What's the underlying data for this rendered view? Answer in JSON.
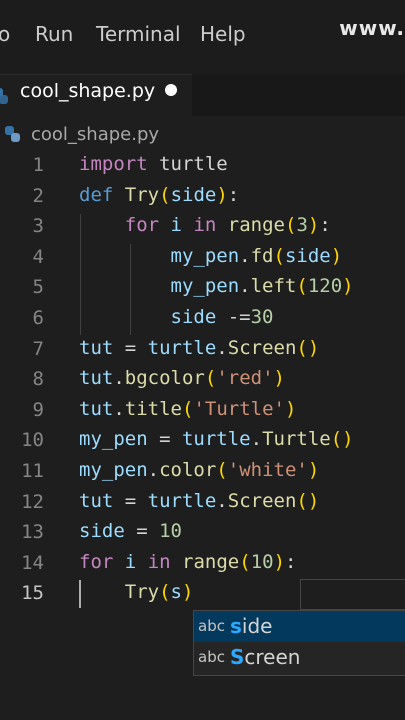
{
  "menubar": {
    "items": [
      "o",
      "Run",
      "Terminal",
      "Help"
    ],
    "watermark": "www."
  },
  "tab": {
    "label": "cool_shape.py",
    "dirty": true
  },
  "breadcrumb": {
    "file": "cool_shape.py"
  },
  "editor": {
    "active_line": 15,
    "lines": [
      {
        "n": "1",
        "tokens": [
          [
            "import",
            "ctl"
          ],
          [
            " turtle",
            ""
          ]
        ]
      },
      {
        "n": "2",
        "tokens": [
          [
            "def",
            "kw"
          ],
          [
            " ",
            ""
          ],
          [
            "Try",
            "fn"
          ],
          [
            "(",
            "bp"
          ],
          [
            "side",
            "var"
          ],
          [
            ")",
            "bp"
          ],
          [
            ":",
            ""
          ]
        ]
      },
      {
        "n": "3",
        "tokens": [
          [
            "    ",
            ""
          ],
          [
            "for",
            "ctl"
          ],
          [
            " ",
            ""
          ],
          [
            "i",
            "var"
          ],
          [
            " ",
            ""
          ],
          [
            "in",
            "ctl"
          ],
          [
            " ",
            ""
          ],
          [
            "range",
            "fn"
          ],
          [
            "(",
            "bp"
          ],
          [
            "3",
            "num"
          ],
          [
            ")",
            "bp"
          ],
          [
            ":",
            ""
          ]
        ]
      },
      {
        "n": "4",
        "tokens": [
          [
            "        ",
            ""
          ],
          [
            "my_pen",
            "var"
          ],
          [
            ".",
            ""
          ],
          [
            "fd",
            "fn"
          ],
          [
            "(",
            "bp"
          ],
          [
            "side",
            "var"
          ],
          [
            ")",
            "bp"
          ]
        ]
      },
      {
        "n": "5",
        "tokens": [
          [
            "        ",
            ""
          ],
          [
            "my_pen",
            "var"
          ],
          [
            ".",
            ""
          ],
          [
            "left",
            "fn"
          ],
          [
            "(",
            "bp"
          ],
          [
            "120",
            "num"
          ],
          [
            ")",
            "bp"
          ]
        ]
      },
      {
        "n": "6",
        "tokens": [
          [
            "        ",
            ""
          ],
          [
            "side",
            "var"
          ],
          [
            " -=",
            ""
          ],
          [
            "30",
            "num"
          ]
        ]
      },
      {
        "n": "7",
        "tokens": [
          [
            "tut",
            "var"
          ],
          [
            " = ",
            ""
          ],
          [
            "turtle",
            "var"
          ],
          [
            ".",
            ""
          ],
          [
            "Screen",
            "fn"
          ],
          [
            "()",
            "bp"
          ]
        ]
      },
      {
        "n": "8",
        "tokens": [
          [
            "tut",
            "var"
          ],
          [
            ".",
            ""
          ],
          [
            "bgcolor",
            "fn"
          ],
          [
            "(",
            "bp"
          ],
          [
            "'red'",
            "str"
          ],
          [
            ")",
            "bp"
          ]
        ]
      },
      {
        "n": "9",
        "tokens": [
          [
            "tut",
            "var"
          ],
          [
            ".",
            ""
          ],
          [
            "title",
            "fn"
          ],
          [
            "(",
            "bp"
          ],
          [
            "'Turtle'",
            "str"
          ],
          [
            ")",
            "bp"
          ]
        ]
      },
      {
        "n": "10",
        "tokens": [
          [
            "my_pen",
            "var"
          ],
          [
            " = ",
            ""
          ],
          [
            "turtle",
            "var"
          ],
          [
            ".",
            ""
          ],
          [
            "Turtle",
            "fn"
          ],
          [
            "()",
            "bp"
          ]
        ]
      },
      {
        "n": "11",
        "tokens": [
          [
            "my_pen",
            "var"
          ],
          [
            ".",
            ""
          ],
          [
            "color",
            "fn"
          ],
          [
            "(",
            "bp"
          ],
          [
            "'white'",
            "str"
          ],
          [
            ")",
            "bp"
          ]
        ]
      },
      {
        "n": "12",
        "tokens": [
          [
            "tut",
            "var"
          ],
          [
            " = ",
            ""
          ],
          [
            "turtle",
            "var"
          ],
          [
            ".",
            ""
          ],
          [
            "Screen",
            "fn"
          ],
          [
            "()",
            "bp"
          ]
        ]
      },
      {
        "n": "13",
        "tokens": [
          [
            "side",
            "var"
          ],
          [
            " = ",
            ""
          ],
          [
            "10",
            "num"
          ]
        ]
      },
      {
        "n": "14",
        "tokens": [
          [
            "for",
            "ctl"
          ],
          [
            " ",
            ""
          ],
          [
            "i",
            "var"
          ],
          [
            " ",
            ""
          ],
          [
            "in",
            "ctl"
          ],
          [
            " ",
            ""
          ],
          [
            "range",
            "fn"
          ],
          [
            "(",
            "bp"
          ],
          [
            "10",
            "num"
          ],
          [
            ")",
            "bp"
          ],
          [
            ":",
            ""
          ]
        ]
      },
      {
        "n": "15",
        "tokens": [
          [
            "    ",
            ""
          ],
          [
            "Try",
            "fn"
          ],
          [
            "(",
            "bp"
          ],
          [
            "s",
            "var"
          ],
          [
            ")",
            "bp"
          ]
        ]
      }
    ]
  },
  "suggest": {
    "items": [
      {
        "kind": "abc",
        "match": "s",
        "rest": "ide",
        "selected": true
      },
      {
        "kind": "abc",
        "match": "S",
        "rest": "creen",
        "selected": false
      }
    ]
  },
  "colors": {
    "keyword": "#569cd6",
    "control": "#c586c0",
    "function": "#dcdcaa",
    "variable": "#9cdcfe",
    "number": "#b5cea8",
    "string": "#ce9178",
    "bracket": "#ffd700",
    "suggest_selected": "#04395e",
    "suggest_match": "#2aaaff"
  },
  "icons": {
    "file": "python-icon",
    "dirty": "unsaved-dot-icon",
    "suggest_kind": "text-kind-icon"
  }
}
